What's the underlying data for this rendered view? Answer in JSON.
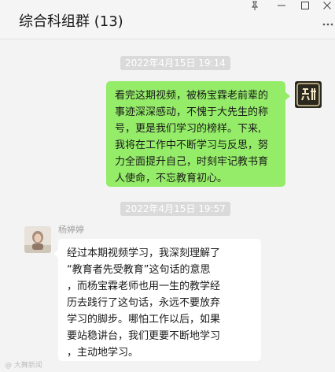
{
  "window": {
    "title": "综合科组群 (13)"
  },
  "messages": [
    {
      "timestamp": "2022年4月15日 19:14",
      "side": "self",
      "lines": [
        "看完这期视频，被杨宝霖老前辈的",
        "事迹深深感动，不愧于大先生的称",
        "号，更是我们学习的榜样。下来,",
        "我将在工作中不断学习与反思，努",
        "力全面提升自己，时刻牢记教书育",
        "人使命，不忘教育初心。"
      ]
    },
    {
      "timestamp": "2022年4月15日 19:57",
      "side": "other",
      "sender": "杨婷婷",
      "lines": [
        "经过本期视频学习，我深刻理解了",
        "“教育者先受教育”这句话的意思",
        "，而杨宝霖老师也用一生的教学经",
        "历去践行了这句话，永远不要放弃",
        "学习的脚步。哪怕工作以后，如果",
        "要站稳讲台，我们更要不断地学习",
        "，主动地学习。"
      ]
    }
  ],
  "watermark": "@ 大舞新闻",
  "colors": {
    "self_bubble": "#95ec69",
    "other_bubble": "#ffffff",
    "background": "#f3f3f3"
  }
}
